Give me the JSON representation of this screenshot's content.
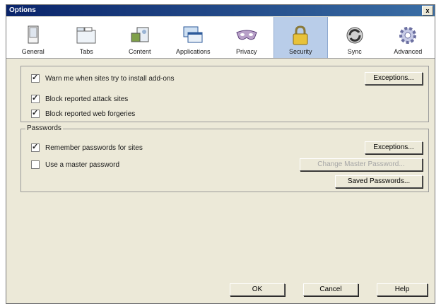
{
  "window": {
    "title": "Options",
    "close_glyph": "x"
  },
  "toolbar": {
    "tabs": [
      {
        "label": "General",
        "icon": "general-icon"
      },
      {
        "label": "Tabs",
        "icon": "tabs-icon"
      },
      {
        "label": "Content",
        "icon": "content-icon"
      },
      {
        "label": "Applications",
        "icon": "applications-icon"
      },
      {
        "label": "Privacy",
        "icon": "privacy-mask-icon"
      },
      {
        "label": "Security",
        "icon": "padlock-icon",
        "selected": true
      },
      {
        "label": "Sync",
        "icon": "sync-icon"
      },
      {
        "label": "Advanced",
        "icon": "gear-icon"
      }
    ]
  },
  "security": {
    "warn_addons": {
      "label": "Warn me when sites try to install add-ons",
      "checked": true
    },
    "block_attack": {
      "label": "Block reported attack sites",
      "checked": true
    },
    "block_forgeries": {
      "label": "Block reported web forgeries",
      "checked": true
    },
    "exceptions_label": "Exceptions..."
  },
  "passwords": {
    "legend": "Passwords",
    "remember": {
      "label": "Remember passwords for sites",
      "checked": true
    },
    "master": {
      "label": "Use a master password",
      "checked": false
    },
    "exceptions_label": "Exceptions...",
    "change_master_label": "Change Master Password...",
    "saved_label": "Saved Passwords..."
  },
  "footer": {
    "ok": "OK",
    "cancel": "Cancel",
    "help": "Help"
  },
  "colors": {
    "title_bar": "#0a246a",
    "dialog_bg": "#ece9d8",
    "selected_tab": "#b9cde9"
  }
}
